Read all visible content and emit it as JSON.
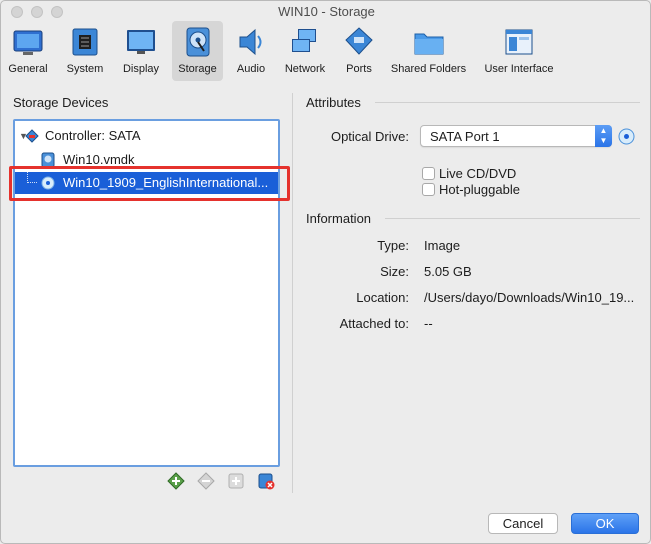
{
  "window": {
    "title": "WIN10 - Storage"
  },
  "toolbar": {
    "items": [
      {
        "label": "General",
        "icon": "general-icon"
      },
      {
        "label": "System",
        "icon": "system-chip-icon"
      },
      {
        "label": "Display",
        "icon": "display-monitor-icon"
      },
      {
        "label": "Storage",
        "icon": "storage-disk-icon",
        "active": true
      },
      {
        "label": "Audio",
        "icon": "audio-speaker-icon"
      },
      {
        "label": "Network",
        "icon": "network-icon"
      },
      {
        "label": "Ports",
        "icon": "ports-icon"
      },
      {
        "label": "Shared Folders",
        "icon": "shared-folder-icon"
      },
      {
        "label": "User Interface",
        "icon": "user-interface-icon"
      }
    ]
  },
  "storage_devices": {
    "title": "Storage Devices",
    "controller": "Controller: SATA",
    "items": [
      {
        "label": "Win10.vmdk",
        "icon": "hard-disk-icon"
      },
      {
        "label": "Win10_1909_EnglishInternational...",
        "icon": "optical-disc-icon",
        "selected": true
      }
    ],
    "buttons": [
      "add-controller-icon",
      "remove-controller-icon",
      "add-attachment-icon",
      "remove-attachment-icon"
    ]
  },
  "attributes": {
    "title": "Attributes",
    "optical_drive_label": "Optical Drive:",
    "optical_drive_value": "SATA Port 1",
    "live_cd_label": "Live CD/DVD",
    "hot_pluggable_label": "Hot-pluggable"
  },
  "information": {
    "title": "Information",
    "type_label": "Type:",
    "type_value": "Image",
    "size_label": "Size:",
    "size_value": "5.05 GB",
    "location_label": "Location:",
    "location_value": "/Users/dayo/Downloads/Win10_19...",
    "attached_label": "Attached to:",
    "attached_value": "--"
  },
  "footer": {
    "cancel": "Cancel",
    "ok": "OK"
  },
  "colors": {
    "accent": "#1a5fd8",
    "highlight": "#e5322d",
    "tree_border": "#6a9ee0"
  }
}
